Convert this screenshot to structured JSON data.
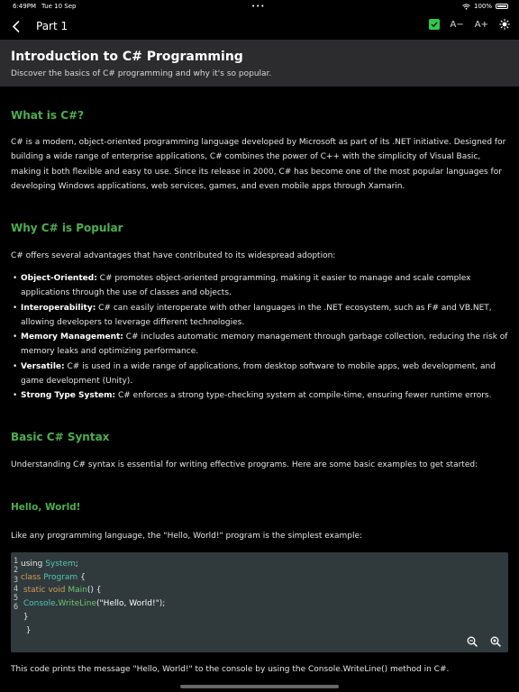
{
  "status": {
    "time": "6:49PM",
    "date": "Tue 10 Sep",
    "dots": "•••",
    "battery_text": "100%"
  },
  "nav": {
    "title": "Part 1",
    "font_decrease": "A−",
    "font_increase": "A+"
  },
  "header": {
    "title": "Introduction to C# Programming",
    "subtitle": "Discover the basics of C# programming and why it's so popular."
  },
  "sections": {
    "what": {
      "heading": "What is C#?",
      "body": "C# is a modern, object-oriented programming language developed by Microsoft as part of its .NET initiative. Designed for building a wide range of enterprise applications, C# combines the power of C++ with the simplicity of Visual Basic, making it both flexible and easy to use. Since its release in 2000, C# has become one of the most popular languages for developing Windows applications, web services, games, and even mobile apps through Xamarin."
    },
    "why": {
      "heading": "Why C# is Popular",
      "intro": "C# offers several advantages that have contributed to its widespread adoption:",
      "bullets": [
        {
          "term": "Object-Oriented:",
          "text": " C# promotes object-oriented programming, making it easier to manage and scale complex applications through the use of classes and objects."
        },
        {
          "term": "Interoperability:",
          "text": " C# can easily interoperate with other languages in the .NET ecosystem, such as F# and VB.NET, allowing developers to leverage different technologies."
        },
        {
          "term": "Memory Management:",
          "text": " C# includes automatic memory management through garbage collection, reducing the risk of memory leaks and optimizing performance."
        },
        {
          "term": "Versatile:",
          "text": " C# is used in a wide range of applications, from desktop software to mobile apps, web development, and game development (Unity)."
        },
        {
          "term": "Strong Type System:",
          "text": " C# enforces a strong type-checking system at compile-time, ensuring fewer runtime errors."
        }
      ]
    },
    "syntax": {
      "heading": "Basic C# Syntax",
      "body": "Understanding C# syntax is essential for writing effective programs. Here are some basic examples to get started:",
      "hello_heading": "Hello, World!",
      "hello_body": "Like any programming language, the \"Hello, World!\" program is the simplest example:",
      "footer": "This code prints the message \"Hello, World!\" to the console by using the Console.WriteLine() method in C#."
    }
  },
  "code": {
    "line_numbers": [
      "1",
      "2",
      "3",
      "4",
      "5",
      "6"
    ],
    "tokens": {
      "using": "using",
      "system": "System",
      "semi": ";",
      "class_kw": "class",
      "program": "Program",
      "open_brace": " {",
      "static_void": "static void",
      "main": "Main",
      "main_sig": "() {",
      "console": "Console",
      "dot": ".",
      "writeline": "WriteLine",
      "arg_open": "(",
      "string": "\"Hello, World!\"",
      "arg_close": ");",
      "close1": "}",
      "close2": "}"
    }
  }
}
